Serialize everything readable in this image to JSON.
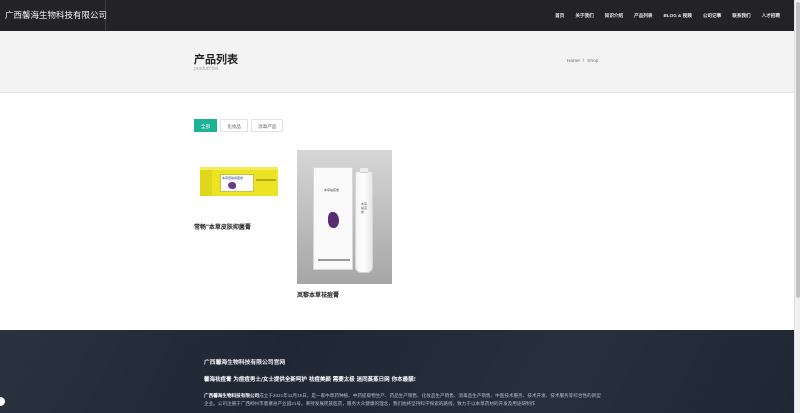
{
  "header": {
    "brand": "广西馨海生物科技有限公司",
    "nav": [
      "首页",
      "关于我们",
      "知识介绍",
      "产品列表",
      "BLOG & 视频",
      "公司记事",
      "联系我们",
      "人才招聘"
    ]
  },
  "banner": {
    "title": "产品列表",
    "subtitle": "product list",
    "breadcrumb": {
      "home": "Home",
      "separator": "/",
      "current": "Shop"
    }
  },
  "filters": [
    {
      "label": "全部",
      "active": true
    },
    {
      "label": "化妆品",
      "active": false
    },
    {
      "label": "消毒产品",
      "active": false
    }
  ],
  "products": [
    {
      "name": "常畅\"本草皮肤抑菌膏",
      "box_text": "本草皮肤抑菌膏"
    },
    {
      "name": "岚黎本草祛痘膏",
      "box_text": "本草祛痘膏"
    }
  ],
  "footer": {
    "title": "广西馨海生物科技有限公司官网",
    "slogan": "馨海祛痘膏 为痘痘男士/女士提供全新呵护 祛痘美颜 需要太极 迷同蒸蒸日网 你本最靓!",
    "company": "广西馨海生物科技有限公司",
    "intro": "成立于2021年11月15日，是一家中草药种植、中药提取物生产、药品生产销售、化妆品生产销售、消毒品生产销售、中医技术服务、技术开发、技术服务等综合性的新型企业。公司注册于广西柳州市鹿寨县产业园21号。秉持发展民族医药，服务大众健康的理念，我们始终坚持科学探索的路线，致力于以本草药材的开发及用途研制作"
  },
  "colors": {
    "accent": "#1bb394",
    "topbar": "#232325",
    "footer": "#1f2735",
    "banner": "#f3f3f3"
  }
}
